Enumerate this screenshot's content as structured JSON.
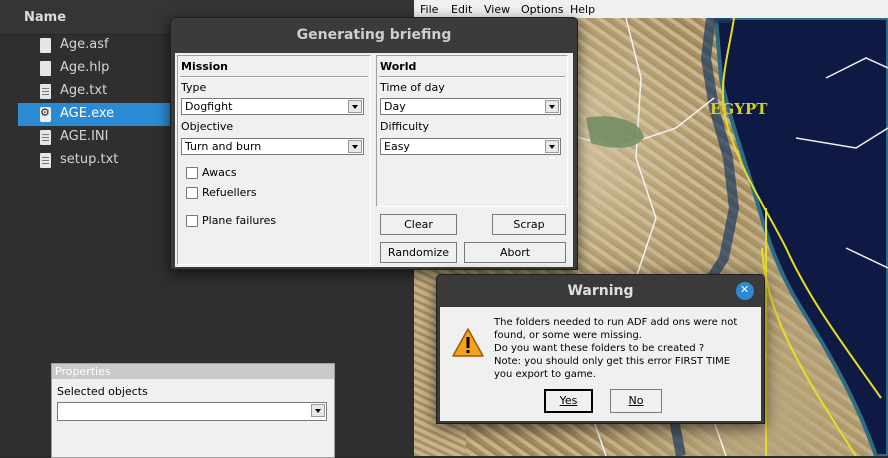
{
  "file_manager": {
    "column_header": "Name",
    "files": [
      {
        "name": "Age.asf",
        "icon": "document-icon",
        "selected": false
      },
      {
        "name": "Age.hlp",
        "icon": "document-icon",
        "selected": false
      },
      {
        "name": "Age.txt",
        "icon": "text-file-icon",
        "selected": false
      },
      {
        "name": "AGE.exe",
        "icon": "executable-icon",
        "selected": true
      },
      {
        "name": "AGE.INI",
        "icon": "text-file-icon",
        "selected": false
      },
      {
        "name": "setup.txt",
        "icon": "text-file-icon",
        "selected": false
      }
    ],
    "selection_color": "#2a8ad3"
  },
  "app": {
    "menu": [
      "File",
      "Edit",
      "View",
      "Options",
      "Help"
    ],
    "map_label": "EGYPT"
  },
  "briefing_dialog": {
    "title": "Generating briefing",
    "mission": {
      "heading": "Mission",
      "type_label": "Type",
      "type_value": "Dogfight",
      "objective_label": "Objective",
      "objective_value": "Turn and burn",
      "checkboxes": [
        "Awacs",
        "Refuellers",
        "Plane failures"
      ]
    },
    "world": {
      "heading": "World",
      "time_label": "Time of day",
      "time_value": "Day",
      "difficulty_label": "Difficulty",
      "difficulty_value": "Easy"
    },
    "buttons": {
      "clear": "Clear",
      "scrap": "Scrap",
      "randomize": "Randomize",
      "abort": "Abort"
    }
  },
  "properties_panel": {
    "title": "Properties",
    "selected_label": "Selected objects",
    "selected_value": ""
  },
  "warning_dialog": {
    "title": "Warning",
    "message_lines": [
      "The folders needed to run ADF add ons were not",
      "found, or some were missing.",
      "Do you want these folders to be created ?",
      "Note: you should only get this error FIRST TIME",
      "you export to game."
    ],
    "yes_label": "Yes",
    "no_label": "No",
    "icon": "warning-icon",
    "accent_color": "#2a8ad3"
  }
}
